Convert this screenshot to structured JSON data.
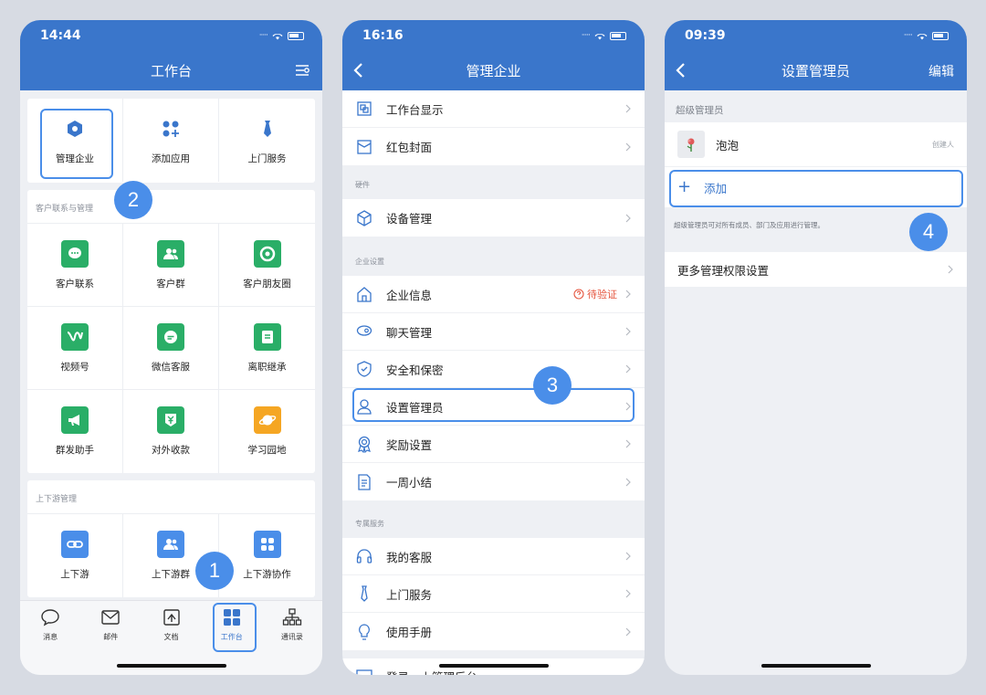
{
  "screen1": {
    "time": "14:44",
    "title": "工作台",
    "top_items": [
      {
        "label": "管理企业",
        "icon": "hexagon-icon"
      },
      {
        "label": "添加应用",
        "icon": "add-apps-icon"
      },
      {
        "label": "上门服务",
        "icon": "tie-icon"
      }
    ],
    "section1": {
      "title": "客户联系与管理",
      "items": [
        {
          "label": "客户联系",
          "icon": "chat-bubble-icon"
        },
        {
          "label": "客户群",
          "icon": "group-icon"
        },
        {
          "label": "客户朋友圈",
          "icon": "moments-icon"
        },
        {
          "label": "视频号",
          "icon": "channels-icon"
        },
        {
          "label": "微信客服",
          "icon": "service-icon"
        },
        {
          "label": "离职继承",
          "icon": "handover-icon"
        },
        {
          "label": "群发助手",
          "icon": "megaphone-icon"
        },
        {
          "label": "对外收款",
          "icon": "payment-icon"
        },
        {
          "label": "学习园地",
          "icon": "planet-icon"
        }
      ]
    },
    "section2": {
      "title": "上下游管理",
      "items": [
        {
          "label": "上下游",
          "icon": "link-icon"
        },
        {
          "label": "上下游群",
          "icon": "group-icon"
        },
        {
          "label": "上下游协作",
          "icon": "grid-icon"
        }
      ]
    },
    "tabs": [
      {
        "label": "消息",
        "icon": "message-icon"
      },
      {
        "label": "邮件",
        "icon": "mail-icon"
      },
      {
        "label": "文档",
        "icon": "doc-icon"
      },
      {
        "label": "工作台",
        "icon": "workbench-icon",
        "active": true
      },
      {
        "label": "通讯录",
        "icon": "contacts-icon"
      }
    ],
    "badges": [
      "1",
      "2"
    ]
  },
  "screen2": {
    "time": "16:16",
    "title": "管理企业",
    "group0": [
      "工作台显示",
      "红包封面"
    ],
    "group1": {
      "title": "硬件",
      "items": [
        "设备管理"
      ]
    },
    "group2": {
      "title": "企业设置",
      "items": [
        "企业信息",
        "聊天管理",
        "安全和保密",
        "设置管理员",
        "奖励设置",
        "一周小结"
      ],
      "verify": "待验证"
    },
    "group3": {
      "title": "专属服务",
      "items": [
        "我的客服",
        "上门服务",
        "使用手册"
      ]
    },
    "partial_item": "登录…上管理后台",
    "badge": "3"
  },
  "screen3": {
    "time": "09:39",
    "title": "设置管理员",
    "edit": "编辑",
    "section_title": "超级管理员",
    "admin_name": "泡泡",
    "admin_role": "创建人",
    "add_label": "添加",
    "note": "超级管理员可对所有成员、部门及应用进行管理。",
    "more": "更多管理权限设置",
    "badge": "4"
  },
  "colors": {
    "primary": "#3a76cb",
    "highlight": "#4a8ee9",
    "green": "#2aae67",
    "blue_tile": "#4a8ee9",
    "orange": "#f5a623"
  }
}
